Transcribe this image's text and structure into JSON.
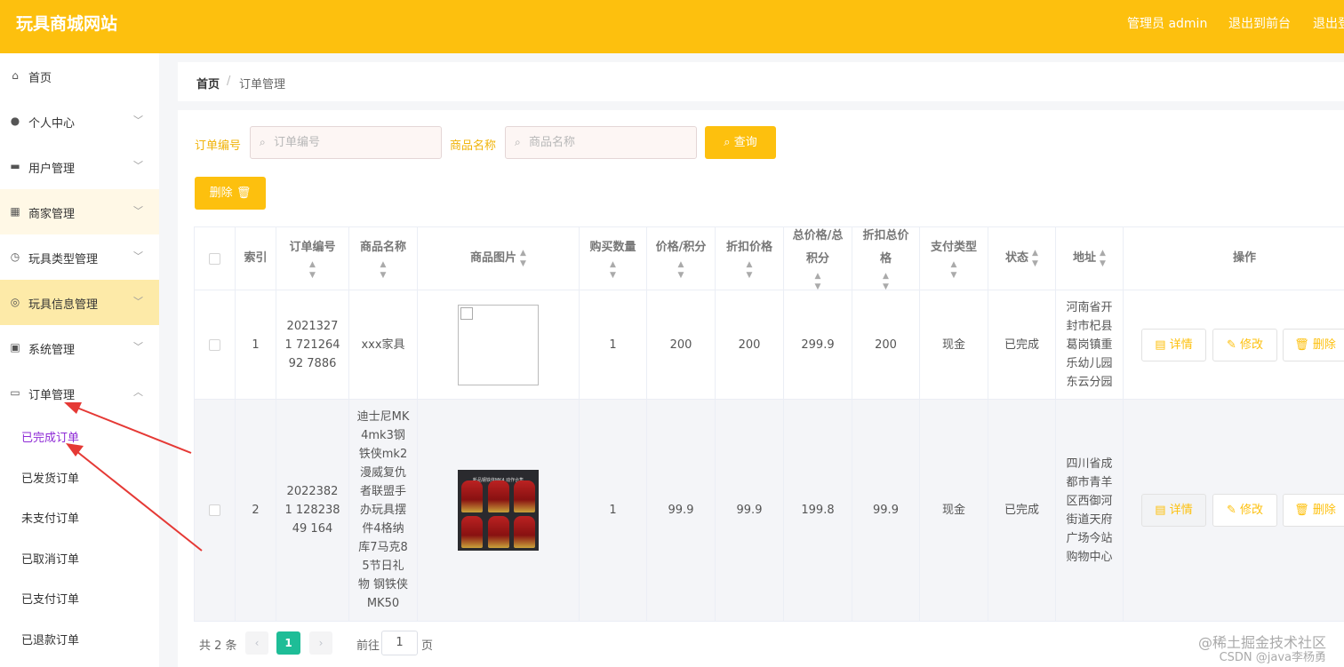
{
  "header": {
    "site_title": "玩具商城网站",
    "admin_label": "管理员 admin",
    "exit_front": "退出到前台",
    "exit_login": "退出登录"
  },
  "sidebar": {
    "items": [
      {
        "label": "首页",
        "icon": "home-icon"
      },
      {
        "label": "个人中心",
        "icon": "user-icon"
      },
      {
        "label": "用户管理",
        "icon": "ticket-icon"
      },
      {
        "label": "商家管理",
        "icon": "grid-icon"
      },
      {
        "label": "玩具类型管理",
        "icon": "clock-icon"
      },
      {
        "label": "玩具信息管理",
        "icon": "compass-icon"
      },
      {
        "label": "系统管理",
        "icon": "briefcase-icon"
      },
      {
        "label": "订单管理",
        "icon": "chat-icon"
      }
    ],
    "sub_items": [
      "已完成订单",
      "已发货订单",
      "未支付订单",
      "已取消订单",
      "已支付订单",
      "已退款订单"
    ]
  },
  "breadcrumb": {
    "home": "首页",
    "separator": "/",
    "current": "订单管理"
  },
  "search": {
    "order_no_label": "订单编号",
    "order_no_placeholder": "订单编号",
    "product_name_label": "商品名称",
    "product_name_placeholder": "商品名称",
    "query_label": "查询",
    "delete_label": "删除"
  },
  "table": {
    "headers": {
      "index": "索引",
      "order_no": "订单编号",
      "product_name": "商品名称",
      "product_image": "商品图片",
      "quantity": "购买数量",
      "price": "价格/积分",
      "discount_price": "折扣价格",
      "total_price": "总价格/总积分",
      "discount_total": "折扣总价格",
      "pay_type": "支付类型",
      "status": "状态",
      "address": "地址",
      "actions": "操作"
    },
    "rows": [
      {
        "index": "1",
        "order_no": "202132717212649278 86",
        "order_no_display": "20213271 72126492 7886",
        "product_name": "xxx家具",
        "quantity": "1",
        "price": "200",
        "discount_price": "200",
        "total_price": "299.9",
        "discount_total": "200",
        "pay_type": "现金",
        "status": "已完成",
        "address": "河南省开封市杞县葛岗镇重乐幼儿园东云分园"
      },
      {
        "index": "2",
        "order_no_display": "20223821 12823849 164",
        "product_name": "迪士尼MK4mk3钢铁侠mk2漫威复仇者联盟手办玩具摆件4格纳库7马克85节日礼物 钢铁侠MK50",
        "image_caption": "新品钢铁侠MK4 动作合集",
        "quantity": "1",
        "price": "99.9",
        "discount_price": "99.9",
        "total_price": "199.8",
        "discount_total": "99.9",
        "pay_type": "现金",
        "status": "已完成",
        "address": "四川省成都市青羊区西御河街道天府广场今站购物中心"
      }
    ],
    "action_labels": {
      "detail": "详情",
      "edit": "修改",
      "delete": "删除"
    }
  },
  "pagination": {
    "total": "共 2 条",
    "current_page": "1",
    "goto": "前往",
    "page_input": "1",
    "page_suffix": "页"
  },
  "watermark": {
    "line1": "@稀土掘金技术社区",
    "line2": "CSDN @java李杨勇"
  },
  "colors": {
    "accent": "#fdc00e",
    "active_page": "#1ebd97",
    "current_sub": "#8e2bd6",
    "arrow": "#e53935"
  }
}
